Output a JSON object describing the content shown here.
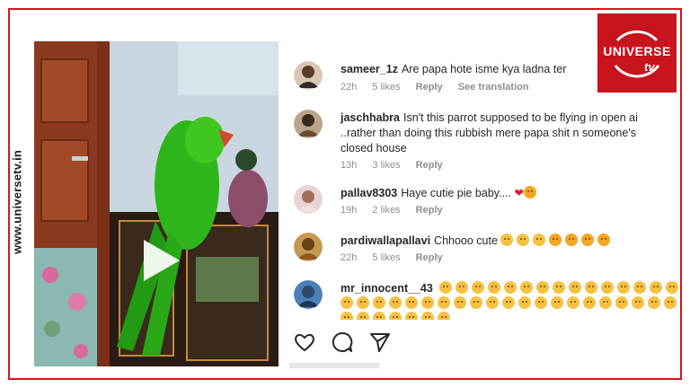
{
  "site": {
    "watermark": "www.universetv.in",
    "brand_name": "UNIVERSE",
    "brand_tv": "tv",
    "accent_color": "#d8141c"
  },
  "video": {
    "play_icon": "play-icon"
  },
  "comments": [
    {
      "username": "sameer_1z",
      "text": "Are papa hote isme kya ladna ter",
      "time": "22h",
      "likes": "5 likes",
      "reply": "Reply",
      "translate": "See translation"
    },
    {
      "username": "jaschhabra",
      "text": "Isn't this parrot supposed to be flying in open ai",
      "text2": "..rather than doing this rubbish mere papa shit n someone's",
      "text3": "closed house",
      "time": "13h",
      "likes": "3 likes",
      "reply": "Reply"
    },
    {
      "username": "pallav8303",
      "text": "Haye cutie pie baby....",
      "time": "19h",
      "likes": "2 likes",
      "reply": "Reply"
    },
    {
      "username": "pardiwallapallavi",
      "text": "Chhooo cute",
      "time": "22h",
      "likes": "5 likes",
      "reply": "Reply"
    },
    {
      "username": "mr_innocent__43",
      "text": ""
    }
  ],
  "actions": {
    "like_icon": "heart-icon",
    "comment_icon": "comment-icon",
    "share_icon": "share-icon"
  }
}
